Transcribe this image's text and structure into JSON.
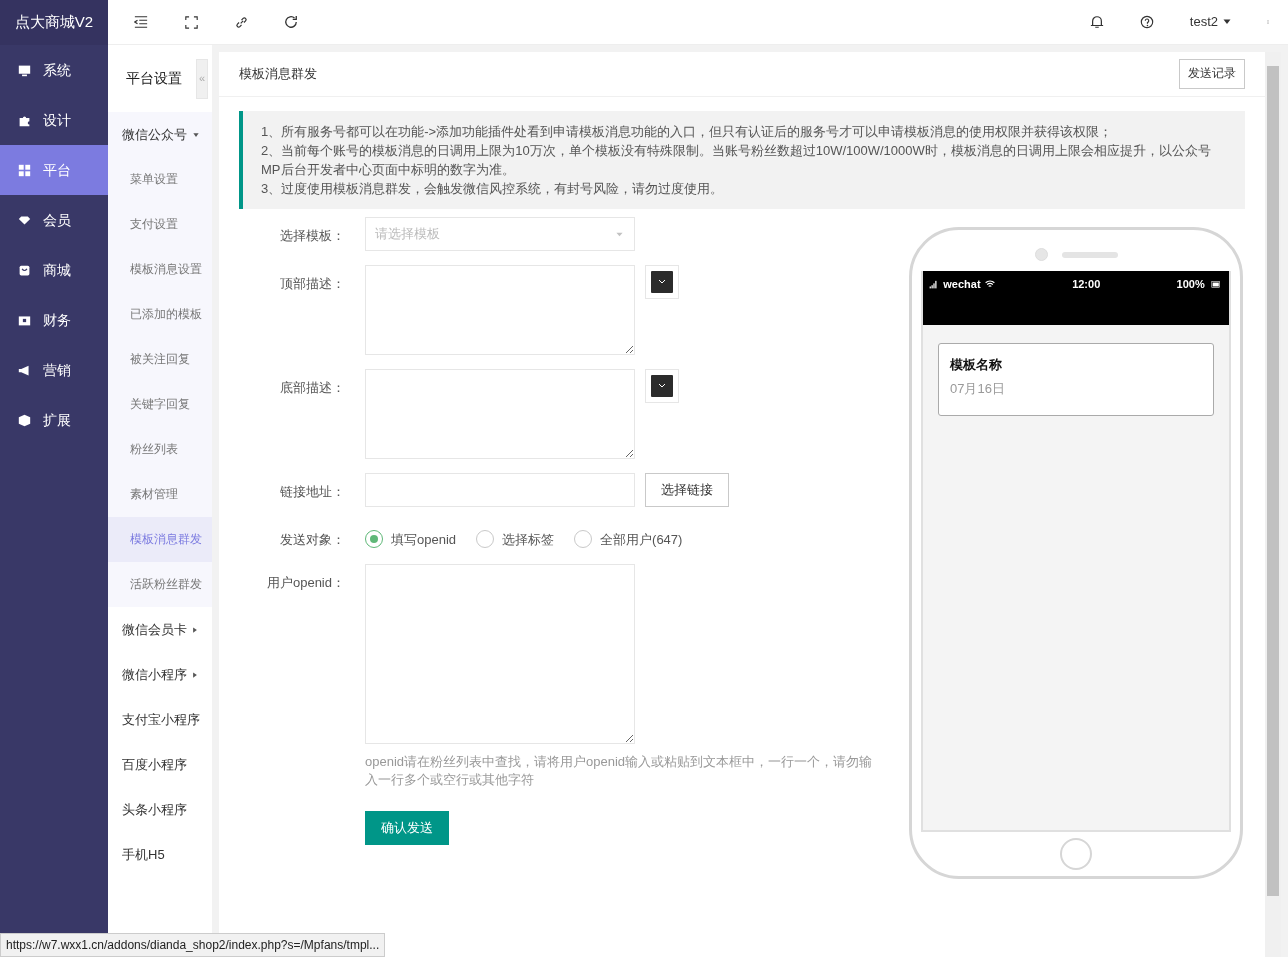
{
  "brand": "点大商城V2",
  "topbar": {
    "user": "test2"
  },
  "main_menu": [
    {
      "label": "系统",
      "selected": false
    },
    {
      "label": "设计",
      "selected": false
    },
    {
      "label": "平台",
      "selected": true
    },
    {
      "label": "会员",
      "selected": false
    },
    {
      "label": "商城",
      "selected": false
    },
    {
      "label": "财务",
      "selected": false
    },
    {
      "label": "营销",
      "selected": false
    },
    {
      "label": "扩展",
      "selected": false
    }
  ],
  "sub_sidebar": {
    "title": "平台设置",
    "collapse": "«",
    "items": [
      {
        "kind": "group",
        "label": "微信公众号",
        "expanded": true,
        "children": [
          {
            "label": "菜单设置",
            "selected": false
          },
          {
            "label": "支付设置",
            "selected": false
          },
          {
            "label": "模板消息设置",
            "selected": false
          },
          {
            "label": "已添加的模板",
            "selected": false
          },
          {
            "label": "被关注回复",
            "selected": false
          },
          {
            "label": "关键字回复",
            "selected": false
          },
          {
            "label": "粉丝列表",
            "selected": false
          },
          {
            "label": "素材管理",
            "selected": false
          },
          {
            "label": "模板消息群发",
            "selected": true
          },
          {
            "label": "活跃粉丝群发",
            "selected": false
          }
        ]
      },
      {
        "kind": "group",
        "label": "微信会员卡",
        "expanded": false
      },
      {
        "kind": "group",
        "label": "微信小程序",
        "expanded": false
      },
      {
        "kind": "link",
        "label": "支付宝小程序"
      },
      {
        "kind": "link",
        "label": "百度小程序"
      },
      {
        "kind": "link",
        "label": "头条小程序"
      },
      {
        "kind": "link",
        "label": "手机H5"
      }
    ]
  },
  "panel": {
    "title": "模板消息群发",
    "header_button": "发送记录",
    "notice": [
      "1、所有服务号都可以在功能->添加功能插件处看到申请模板消息功能的入口，但只有认证后的服务号才可以申请模板消息的使用权限并获得该权限；",
      "2、当前每个账号的模板消息的日调用上限为10万次，单个模板没有特殊限制。当账号粉丝数超过10W/100W/1000W时，模板消息的日调用上限会相应提升，以公众号MP后台开发者中心页面中标明的数字为准。",
      "3、过度使用模板消息群发，会触发微信风控系统，有封号风险，请勿过度使用。"
    ],
    "form": [
      {
        "kind": "select",
        "label": "选择模板：",
        "placeholder": "请选择模板"
      },
      {
        "kind": "textarea_color",
        "label": "顶部描述："
      },
      {
        "kind": "textarea_color",
        "label": "底部描述："
      },
      {
        "kind": "input_button",
        "label": "链接地址：",
        "button": "选择链接"
      },
      {
        "kind": "radios",
        "label": "发送对象：",
        "options": [
          {
            "label": "填写openid",
            "selected": true
          },
          {
            "label": "选择标签",
            "selected": false
          },
          {
            "label": "全部用户(647)",
            "selected": false
          }
        ]
      },
      {
        "kind": "textarea_help",
        "label": "用户openid：",
        "help": "openid请在粉丝列表中查找，请将用户openid输入或粘贴到文本框中，一行一个，请勿输入一行多个或空行或其他字符"
      }
    ],
    "submit": "确认发送"
  },
  "phone": {
    "carrier": "wechat",
    "time": "12:00",
    "battery": "100%",
    "card_title": "模板名称",
    "card_date": "07月16日"
  },
  "status_url": "https://w7.wxx1.cn/addons/dianda_shop2/index.php?s=/Mpfans/tmpl..."
}
